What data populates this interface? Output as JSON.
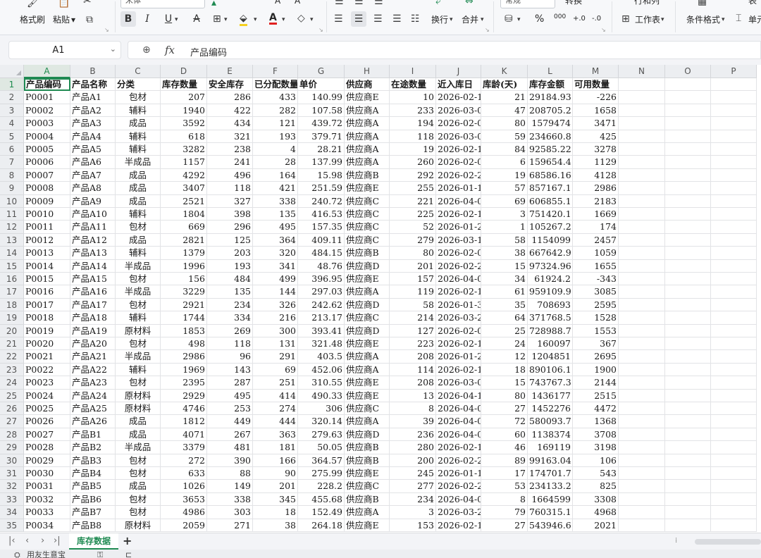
{
  "ribbon": {
    "format_painter": "格式刷",
    "paste": "粘贴",
    "paste_arrow": "▾",
    "font_name": "宋体",
    "number_format": "常规",
    "convert": "转换",
    "wrap": "换行",
    "merge": "合并",
    "percent": "%",
    "thousands": "000",
    "dec_inc": "+.0",
    "dec_dec": "-.0",
    "row_col": "行和列",
    "worksheet": "工作表",
    "cond_format": "条件格式",
    "table_style": "表",
    "freeze": "单元",
    "bold": "B",
    "italic": "I",
    "underline": "U",
    "strike": "A",
    "font_color": "A",
    "font_grow": "A",
    "font_shrink": "A"
  },
  "formula_bar": {
    "cell_ref": "A1",
    "fx": "fx",
    "content": "产品编码"
  },
  "columns": [
    "A",
    "B",
    "C",
    "D",
    "E",
    "F",
    "G",
    "H",
    "I",
    "J",
    "K",
    "L",
    "M",
    "N",
    "O",
    "P"
  ],
  "headers": [
    "产品编码",
    "产品名称",
    "分类",
    "库存数量",
    "安全库存",
    "已分配数量",
    "单价",
    "供应商",
    "在途数量",
    "近入库日",
    "库龄(天)",
    "库存金额",
    "可用数量"
  ],
  "rows": [
    [
      "P0001",
      "产品A1",
      "包材",
      "207",
      "286",
      "433",
      "140.99",
      "供应商E",
      "10",
      "2026-02-1",
      "21",
      "29184.93",
      "-226"
    ],
    [
      "P0002",
      "产品A2",
      "辅料",
      "1940",
      "422",
      "282",
      "107.58",
      "供应商A",
      "233",
      "2026-03-0",
      "47",
      "208705.2",
      "1658"
    ],
    [
      "P0003",
      "产品A3",
      "成品",
      "3592",
      "434",
      "121",
      "439.72",
      "供应商A",
      "194",
      "2026-02-0",
      "80",
      "1579474",
      "3471"
    ],
    [
      "P0004",
      "产品A4",
      "辅料",
      "618",
      "321",
      "193",
      "379.71",
      "供应商A",
      "118",
      "2026-03-0",
      "59",
      "234660.8",
      "425"
    ],
    [
      "P0005",
      "产品A5",
      "辅料",
      "3282",
      "238",
      "4",
      "28.21",
      "供应商A",
      "19",
      "2026-02-1",
      "84",
      "92585.22",
      "3278"
    ],
    [
      "P0006",
      "产品A6",
      "半成品",
      "1157",
      "241",
      "28",
      "137.99",
      "供应商A",
      "260",
      "2026-02-0",
      "6",
      "159654.4",
      "1129"
    ],
    [
      "P0007",
      "产品A7",
      "成品",
      "4292",
      "496",
      "164",
      "15.98",
      "供应商B",
      "292",
      "2026-02-2",
      "19",
      "68586.16",
      "4128"
    ],
    [
      "P0008",
      "产品A8",
      "成品",
      "3407",
      "118",
      "421",
      "251.59",
      "供应商E",
      "255",
      "2026-01-1",
      "57",
      "857167.1",
      "2986"
    ],
    [
      "P0009",
      "产品A9",
      "成品",
      "2521",
      "327",
      "338",
      "240.72",
      "供应商C",
      "221",
      "2026-04-0",
      "69",
      "606855.1",
      "2183"
    ],
    [
      "P0010",
      "产品A10",
      "辅料",
      "1804",
      "398",
      "135",
      "416.53",
      "供应商C",
      "225",
      "2026-02-1",
      "3",
      "751420.1",
      "1669"
    ],
    [
      "P0011",
      "产品A11",
      "包材",
      "669",
      "296",
      "495",
      "157.35",
      "供应商C",
      "52",
      "2026-01-2",
      "1",
      "105267.2",
      "174"
    ],
    [
      "P0012",
      "产品A12",
      "成品",
      "2821",
      "125",
      "364",
      "409.11",
      "供应商C",
      "279",
      "2026-03-1",
      "58",
      "1154099",
      "2457"
    ],
    [
      "P0013",
      "产品A13",
      "辅料",
      "1379",
      "203",
      "320",
      "484.15",
      "供应商B",
      "80",
      "2026-02-0",
      "38",
      "667642.9",
      "1059"
    ],
    [
      "P0014",
      "产品A14",
      "半成品",
      "1996",
      "193",
      "341",
      "48.76",
      "供应商D",
      "201",
      "2026-02-2",
      "15",
      "97324.96",
      "1655"
    ],
    [
      "P0015",
      "产品A15",
      "包材",
      "156",
      "484",
      "499",
      "396.95",
      "供应商E",
      "157",
      "2026-04-0",
      "34",
      "61924.2",
      "-343"
    ],
    [
      "P0016",
      "产品A16",
      "半成品",
      "3229",
      "135",
      "144",
      "297.03",
      "供应商A",
      "119",
      "2026-02-1",
      "61",
      "959109.9",
      "3085"
    ],
    [
      "P0017",
      "产品A17",
      "包材",
      "2921",
      "234",
      "326",
      "242.62",
      "供应商D",
      "58",
      "2026-01-3",
      "35",
      "708693",
      "2595"
    ],
    [
      "P0018",
      "产品A18",
      "辅料",
      "1744",
      "334",
      "216",
      "213.17",
      "供应商C",
      "214",
      "2026-03-2",
      "64",
      "371768.5",
      "1528"
    ],
    [
      "P0019",
      "产品A19",
      "原材料",
      "1853",
      "269",
      "300",
      "393.41",
      "供应商D",
      "127",
      "2026-02-0",
      "25",
      "728988.7",
      "1553"
    ],
    [
      "P0020",
      "产品A20",
      "包材",
      "498",
      "118",
      "131",
      "321.48",
      "供应商E",
      "223",
      "2026-02-1",
      "24",
      "160097",
      "367"
    ],
    [
      "P0021",
      "产品A21",
      "半成品",
      "2986",
      "96",
      "291",
      "403.5",
      "供应商A",
      "208",
      "2026-01-2",
      "12",
      "1204851",
      "2695"
    ],
    [
      "P0022",
      "产品A22",
      "辅料",
      "1969",
      "143",
      "69",
      "452.06",
      "供应商A",
      "114",
      "2026-02-1",
      "18",
      "890106.1",
      "1900"
    ],
    [
      "P0023",
      "产品A23",
      "包材",
      "2395",
      "287",
      "251",
      "310.55",
      "供应商E",
      "208",
      "2026-03-0",
      "15",
      "743767.3",
      "2144"
    ],
    [
      "P0024",
      "产品A24",
      "原材料",
      "2929",
      "495",
      "414",
      "490.33",
      "供应商E",
      "13",
      "2026-04-1",
      "80",
      "1436177",
      "2515"
    ],
    [
      "P0025",
      "产品A25",
      "原材料",
      "4746",
      "253",
      "274",
      "306",
      "供应商C",
      "8",
      "2026-04-0",
      "27",
      "1452276",
      "4472"
    ],
    [
      "P0026",
      "产品A26",
      "成品",
      "1812",
      "449",
      "444",
      "320.14",
      "供应商A",
      "39",
      "2026-04-0",
      "72",
      "580093.7",
      "1368"
    ],
    [
      "P0027",
      "产品B1",
      "成品",
      "4071",
      "267",
      "363",
      "279.63",
      "供应商D",
      "236",
      "2026-04-0",
      "60",
      "1138374",
      "3708"
    ],
    [
      "P0028",
      "产品B2",
      "半成品",
      "3379",
      "481",
      "181",
      "50.05",
      "供应商B",
      "280",
      "2026-02-1",
      "46",
      "169119",
      "3198"
    ],
    [
      "P0029",
      "产品B3",
      "包材",
      "272",
      "390",
      "166",
      "364.57",
      "供应商B",
      "200",
      "2026-02-2",
      "89",
      "99163.04",
      "106"
    ],
    [
      "P0030",
      "产品B4",
      "包材",
      "633",
      "88",
      "90",
      "275.99",
      "供应商E",
      "245",
      "2026-01-1",
      "17",
      "174701.7",
      "543"
    ],
    [
      "P0031",
      "产品B5",
      "成品",
      "1026",
      "149",
      "201",
      "228.2",
      "供应商C",
      "277",
      "2026-02-2",
      "53",
      "234133.2",
      "825"
    ],
    [
      "P0032",
      "产品B6",
      "包材",
      "3653",
      "338",
      "345",
      "455.68",
      "供应商B",
      "234",
      "2026-04-0",
      "8",
      "1664599",
      "3308"
    ],
    [
      "P0033",
      "产品B7",
      "包材",
      "4986",
      "303",
      "18",
      "152.49",
      "供应商A",
      "3",
      "2026-03-2",
      "79",
      "760315.1",
      "4968"
    ],
    [
      "P0034",
      "产品B8",
      "原材料",
      "2059",
      "271",
      "38",
      "264.18",
      "供应商E",
      "153",
      "2026-02-1",
      "27",
      "543946.6",
      "2021"
    ]
  ],
  "sheet_tabs": {
    "active": "库存数据",
    "add": "+"
  },
  "status": {
    "text": "用友生意宝"
  }
}
